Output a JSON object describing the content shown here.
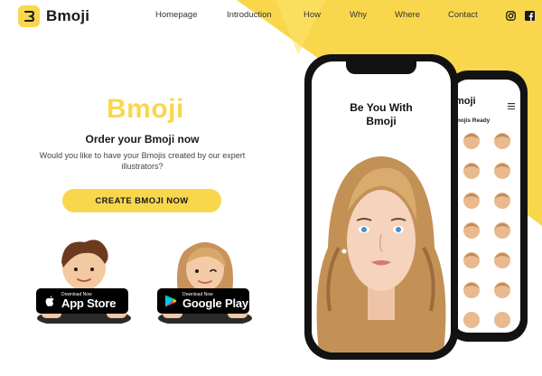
{
  "header": {
    "logo_text": "Bmoji",
    "nav": [
      {
        "label": "Homepage"
      },
      {
        "label": "Introduction"
      },
      {
        "label": "How"
      },
      {
        "label": "Why"
      },
      {
        "label": "Where"
      },
      {
        "label": "Contact"
      }
    ],
    "social": [
      "instagram-icon",
      "facebook-icon"
    ]
  },
  "hero": {
    "logo_text": "Bmoji",
    "title": "Order your Bmoji now",
    "description": "Would you like to have your Bmojis created by our expert illustrators?",
    "cta_label": "CREATE BMOJI NOW"
  },
  "stores": [
    {
      "small": "Download Now",
      "big": "App Store",
      "icon": "apple-icon"
    },
    {
      "small": "Download Now",
      "big": "Google Play",
      "icon": "google-play-icon"
    }
  ],
  "phone_front": {
    "title_line1": "Be You With",
    "title_line2": "Bmoji"
  },
  "phone_back": {
    "logo_text": "moji",
    "subtitle": "mojis Ready"
  },
  "colors": {
    "accent": "#f9d74d",
    "text": "#1a1a1a",
    "phone": "#121212"
  }
}
